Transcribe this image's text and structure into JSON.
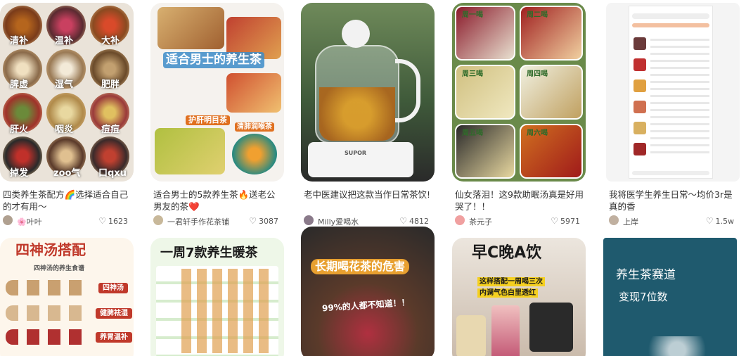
{
  "row1": [
    {
      "title": "四类养生茶配方🌈选择适合自己的才有用～",
      "author": "🌸叶叶",
      "likes": "1623",
      "thumb_labels": [
        "清补",
        "温补",
        "大补",
        "脾虚",
        "湿气",
        "肥胖",
        "肝火",
        "咽炎",
        "痘痘",
        "掉发",
        "zoo气",
        "口qxu"
      ]
    },
    {
      "title": "适合男士的5款养生茶🔥送老公 男友的茶❤️",
      "author": "一君轩手作花茶铺",
      "likes": "3087",
      "thumb_labels": [
        "适合男士的养生茶",
        "护肝明目茶",
        "清肺润喉茶"
      ]
    },
    {
      "title": "老中医建议把这款当作日常茶饮!",
      "author": "Milly爱喝水",
      "likes": "4812",
      "thumb_labels": [
        "SUPOR"
      ]
    },
    {
      "title": "仙女落泪！这9款助眠汤真是好用哭了！！",
      "author": "茶元子",
      "likes": "5971",
      "thumb_labels": [
        "周一喝",
        "周二喝",
        "周三喝",
        "周四喝",
        "周五喝",
        "周六喝"
      ]
    },
    {
      "title": "我将医学生养生日常～均价3r是真的香",
      "author": "上岸",
      "likes": "1.5w",
      "thumb_labels": []
    }
  ],
  "row2": [
    {
      "thumb_labels": [
        "四神汤搭配",
        "四神汤的养生食谱",
        "四神汤",
        "健脾祛湿",
        "养胃温补"
      ]
    },
    {
      "thumb_labels": [
        "一周7款养生暖茶"
      ]
    },
    {
      "thumb_labels": [
        "长期喝花茶的危害",
        "99%的人都不知道！！"
      ]
    },
    {
      "thumb_labels": [
        "早C晚A饮",
        "这样搭配一周喝三次",
        "内调气色白里透红"
      ]
    },
    {
      "thumb_labels": [
        "养生茶赛道",
        "变现7位数"
      ]
    }
  ],
  "colors": {
    "text": "#333333",
    "meta": "#555555",
    "accent_red": "#e5332a",
    "tea_green": "#2f6b2a",
    "dark_teal": "#1f5a6e"
  },
  "icons": {
    "like": "heart-icon"
  }
}
